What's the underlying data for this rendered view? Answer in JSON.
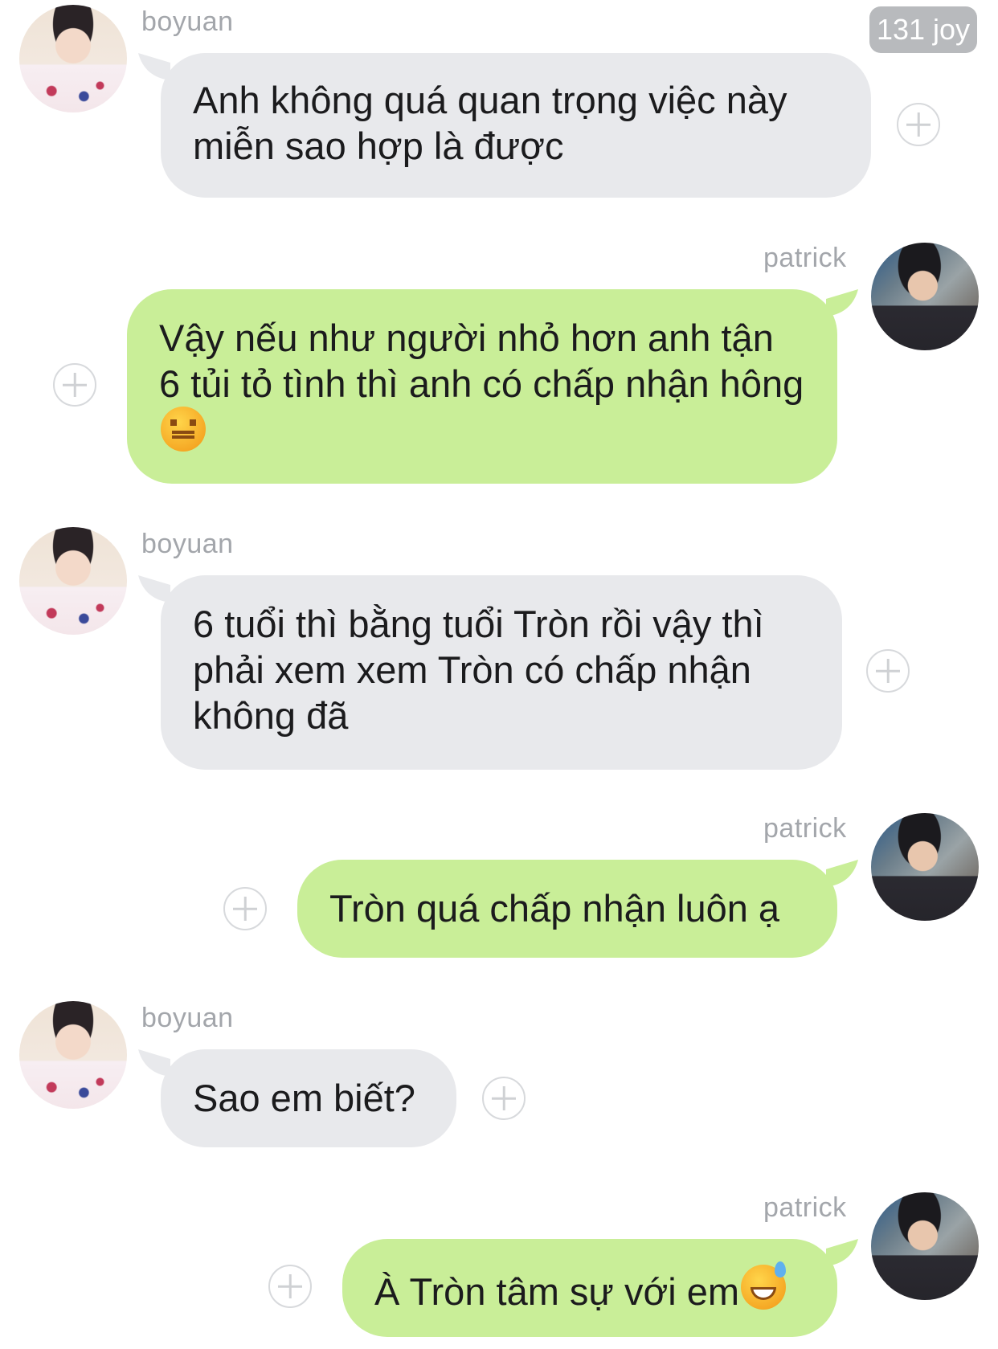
{
  "header": {
    "badge": "131 joy"
  },
  "messages": [
    {
      "sender": "boyuan",
      "text": "Anh không quá quan trọng việc này miễn sao hợp là được",
      "direction": "incoming"
    },
    {
      "sender": "patrick",
      "text": "Vậy nếu như người nhỏ hơn anh tận 6 tủi tỏ tình thì anh có chấp nhận hông",
      "emoji": "confounded-face",
      "direction": "outgoing"
    },
    {
      "sender": "boyuan",
      "text": "6 tuổi thì bằng tuổi Tròn rồi vậy thì phải xem xem Tròn có chấp nhận không đã",
      "direction": "incoming"
    },
    {
      "sender": "patrick",
      "text": "Tròn quá chấp nhận luôn ạ",
      "direction": "outgoing"
    },
    {
      "sender": "boyuan",
      "text": "Sao em biết?",
      "direction": "incoming"
    },
    {
      "sender": "patrick",
      "text": "À Tròn tâm sự với em",
      "emoji": "grinning-sweat-face",
      "direction": "outgoing"
    }
  ],
  "colors": {
    "incoming_bubble": "#e8e9ec",
    "outgoing_bubble": "#c9ee98",
    "name_text": "#a3a6ab",
    "badge": "#b8babd"
  }
}
